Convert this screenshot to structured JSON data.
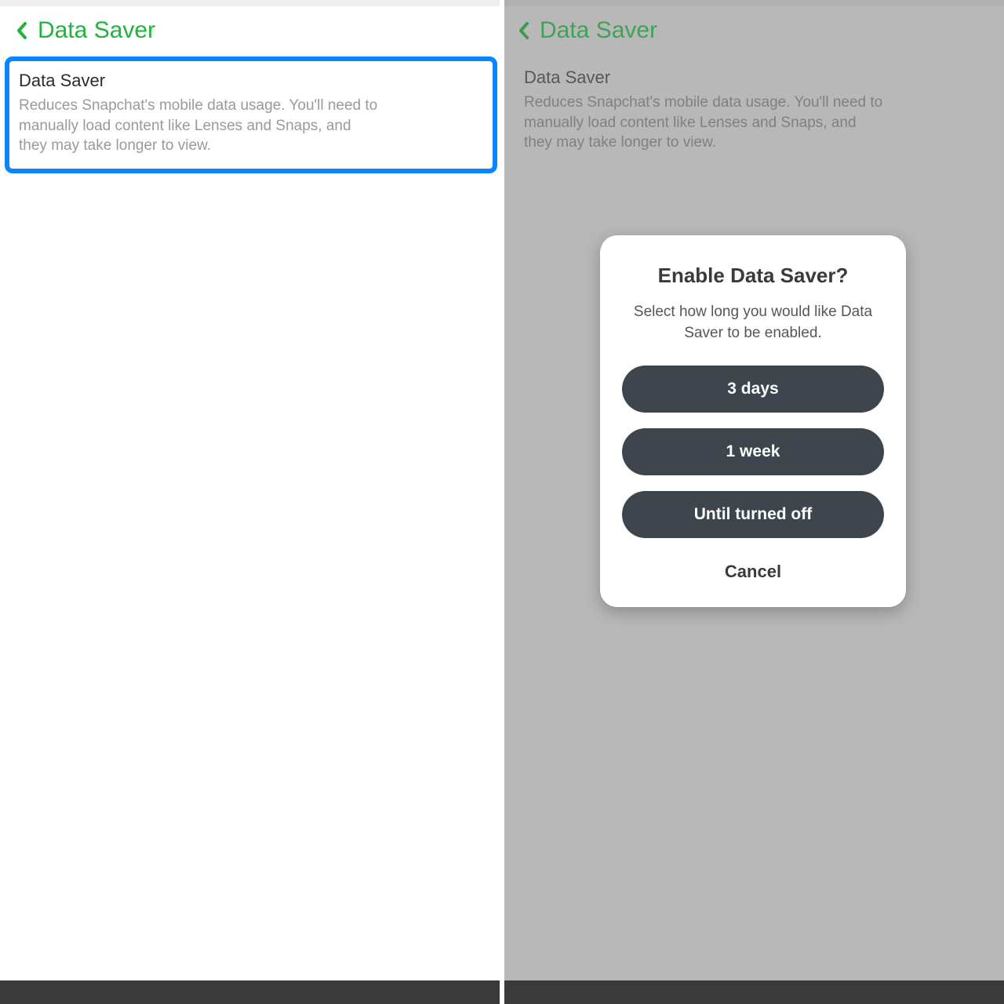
{
  "left": {
    "header_title": "Data Saver",
    "setting_title": "Data Saver",
    "setting_desc": "Reduces Snapchat's mobile data usage. You'll need to manually load content like Lenses and Snaps, and they may take longer to view."
  },
  "right": {
    "header_title": "Data Saver",
    "setting_title": "Data Saver",
    "setting_desc": "Reduces Snapchat's mobile data usage. You'll need to manually load content like Lenses and Snaps, and they may take longer to view.",
    "modal": {
      "title": "Enable Data Saver?",
      "subtitle": "Select how long you would like Data Saver to be enabled.",
      "options": [
        "3 days",
        "1 week",
        "Until turned off"
      ],
      "cancel": "Cancel"
    }
  },
  "colors": {
    "accent_green": "#1eb53a",
    "highlight_blue": "#0a84ff",
    "button_dark": "#3f454d"
  }
}
